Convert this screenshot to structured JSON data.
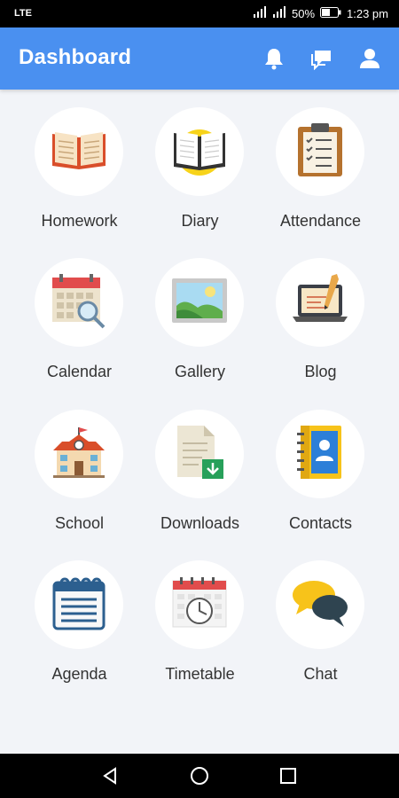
{
  "status": {
    "network": "LTE",
    "battery": "50%",
    "time": "1:23 pm"
  },
  "header": {
    "title": "Dashboard",
    "icons": [
      "bell-icon",
      "chat-bubbles-icon",
      "user-icon"
    ],
    "color": "#4a90f0"
  },
  "tiles": [
    {
      "label": "Homework",
      "icon": "open-book-icon"
    },
    {
      "label": "Diary",
      "icon": "diary-icon"
    },
    {
      "label": "Attendance",
      "icon": "clipboard-checklist-icon"
    },
    {
      "label": "Calendar",
      "icon": "calendar-search-icon"
    },
    {
      "label": "Gallery",
      "icon": "picture-icon"
    },
    {
      "label": "Blog",
      "icon": "laptop-pen-icon"
    },
    {
      "label": "School",
      "icon": "school-building-icon"
    },
    {
      "label": "Downloads",
      "icon": "document-download-icon"
    },
    {
      "label": "Contacts",
      "icon": "address-book-icon"
    },
    {
      "label": "Agenda",
      "icon": "agenda-notepad-icon"
    },
    {
      "label": "Timetable",
      "icon": "timetable-clock-icon"
    },
    {
      "label": "Chat",
      "icon": "speech-bubbles-icon"
    }
  ],
  "navigation": [
    "back-icon",
    "home-icon",
    "recents-icon"
  ]
}
